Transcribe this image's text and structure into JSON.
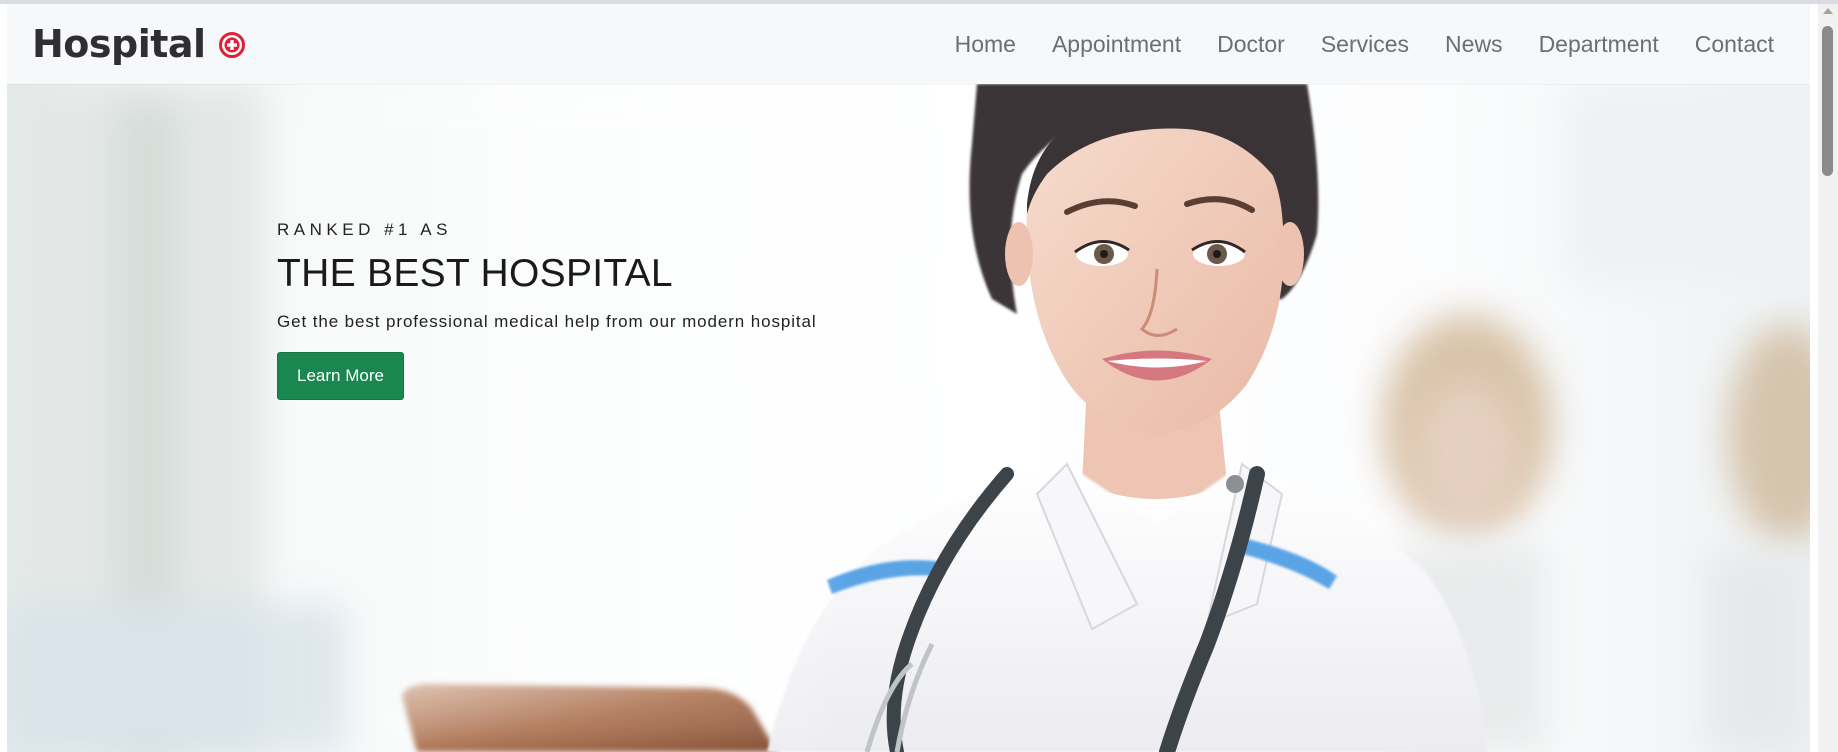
{
  "brand": {
    "name": "Hospital",
    "icon": "red-cross-circle-icon",
    "icon_color": "#e0203a"
  },
  "nav": {
    "items": [
      {
        "label": "Home"
      },
      {
        "label": "Appointment"
      },
      {
        "label": "Doctor"
      },
      {
        "label": "Services"
      },
      {
        "label": "News"
      },
      {
        "label": "Department"
      },
      {
        "label": "Contact"
      }
    ]
  },
  "hero": {
    "eyebrow": "RANKED #1 AS",
    "title": "THE BEST HOSPITAL",
    "subtitle": "Get the best professional medical help from our modern hospital",
    "button_label": "Learn More",
    "button_color": "#19874f",
    "image": "smiling-female-doctor-with-stethoscope-and-tablet"
  },
  "colors": {
    "navbar_bg": "#f7f8fa",
    "nav_text": "#6c6e70",
    "brand_text": "#2f2f33"
  }
}
